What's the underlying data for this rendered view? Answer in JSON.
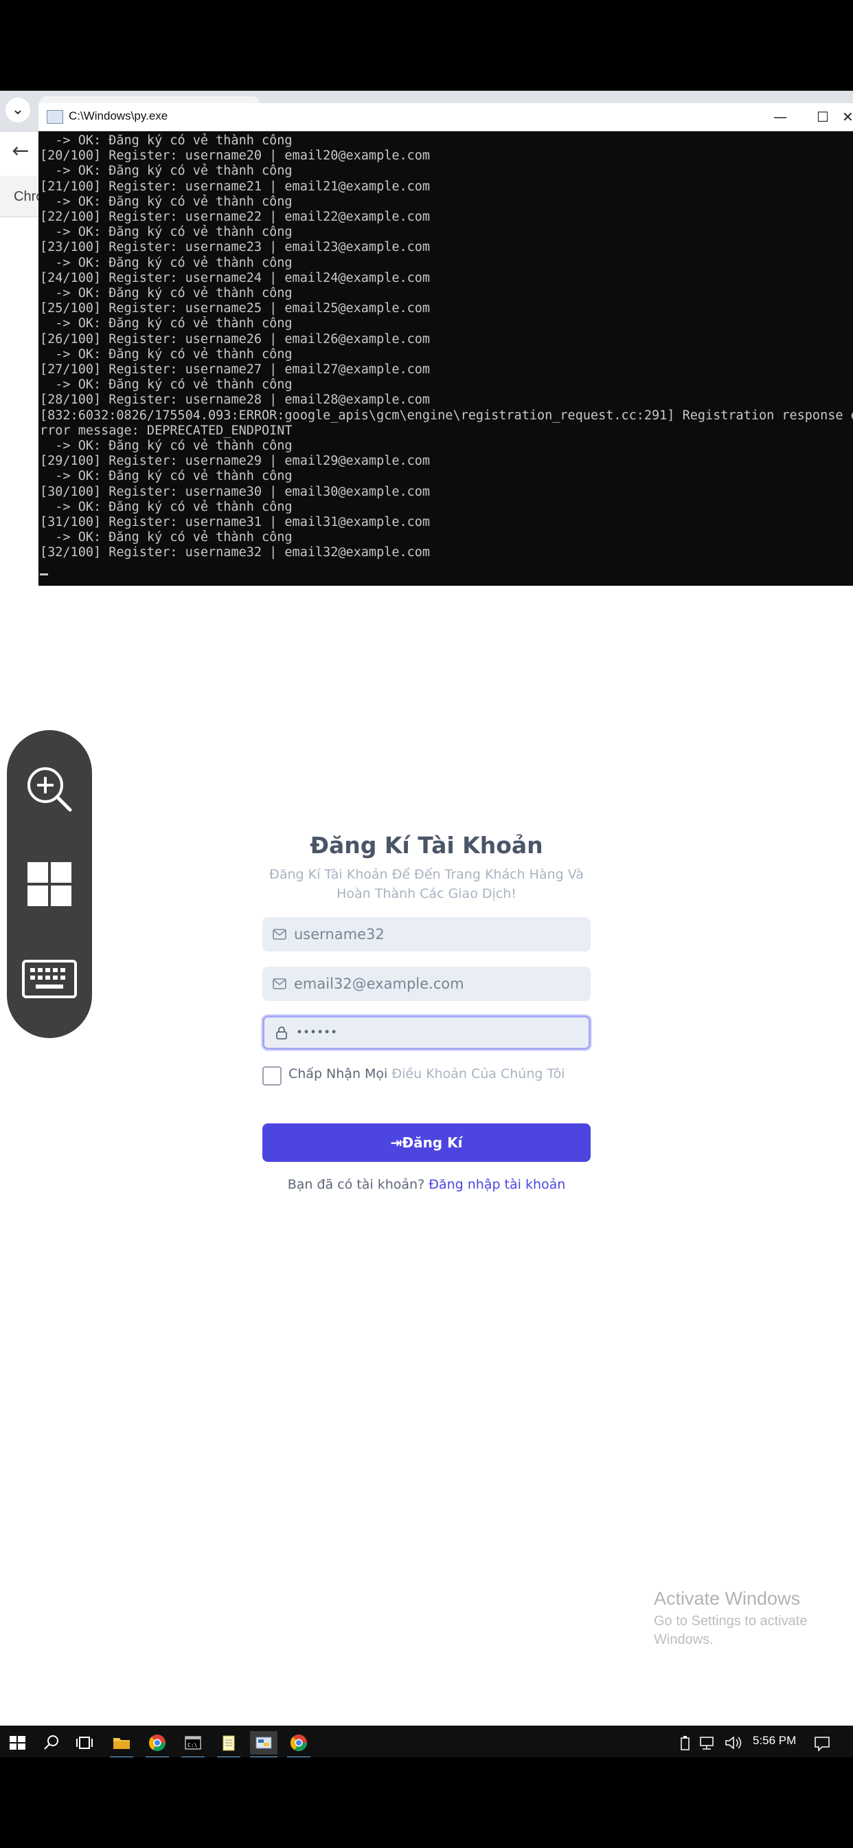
{
  "browser": {
    "dropdown_glyph": "⌄",
    "back_glyph": "←",
    "tab_stub_text": "Chro"
  },
  "console": {
    "title": "C:\\Windows\\py.exe",
    "minimize": "—",
    "maximize": "☐",
    "close": "✕",
    "lines": [
      "  -> OK: Đăng ký có vẻ thành công",
      "[20/100] Register: username20 | email20@example.com",
      "  -> OK: Đăng ký có vẻ thành công",
      "[21/100] Register: username21 | email21@example.com",
      "  -> OK: Đăng ký có vẻ thành công",
      "[22/100] Register: username22 | email22@example.com",
      "  -> OK: Đăng ký có vẻ thành công",
      "[23/100] Register: username23 | email23@example.com",
      "  -> OK: Đăng ký có vẻ thành công",
      "[24/100] Register: username24 | email24@example.com",
      "  -> OK: Đăng ký có vẻ thành công",
      "[25/100] Register: username25 | email25@example.com",
      "  -> OK: Đăng ký có vẻ thành công",
      "[26/100] Register: username26 | email26@example.com",
      "  -> OK: Đăng ký có vẻ thành công",
      "[27/100] Register: username27 | email27@example.com",
      "  -> OK: Đăng ký có vẻ thành công",
      "[28/100] Register: username28 | email28@example.com",
      "[832:6032:0826/175504.093:ERROR:google_apis\\gcm\\engine\\registration_request.cc:291] Registration response e",
      "rror message: DEPRECATED_ENDPOINT",
      "  -> OK: Đăng ký có vẻ thành công",
      "[29/100] Register: username29 | email29@example.com",
      "  -> OK: Đăng ký có vẻ thành công",
      "[30/100] Register: username30 | email30@example.com",
      "  -> OK: Đăng ký có vẻ thành công",
      "[31/100] Register: username31 | email31@example.com",
      "  -> OK: Đăng ký có vẻ thành công",
      "[32/100] Register: username32 | email32@example.com"
    ]
  },
  "tools": {
    "zoom": "zoom-in-icon",
    "windows": "windows-icon",
    "keyboard": "keyboard-icon"
  },
  "form": {
    "title": "Đăng Kí Tài Khoản",
    "subtitle": "Đăng Kí Tài Khoản Để Đến Trang Khách Hàng Và Hoàn Thành Các Giao Dịch!",
    "username_value": "username32",
    "email_value": "email32@example.com",
    "password_value": "••••••",
    "terms_label_dark": "Chấp Nhận Mọi",
    "terms_label_light": "Điều Khoản Của Chúng Tôi",
    "submit_icon": "⇥",
    "submit_label": "Đăng Kí",
    "login_prompt": "Bạn đã có tài khoản?",
    "login_link": "Đăng nhập tài khoản",
    "accent_color": "#4c45e0"
  },
  "watermark": {
    "title": "Activate Windows",
    "subtitle": "Go to Settings to activate Windows."
  },
  "taskbar": {
    "time": "5:56 PM"
  }
}
